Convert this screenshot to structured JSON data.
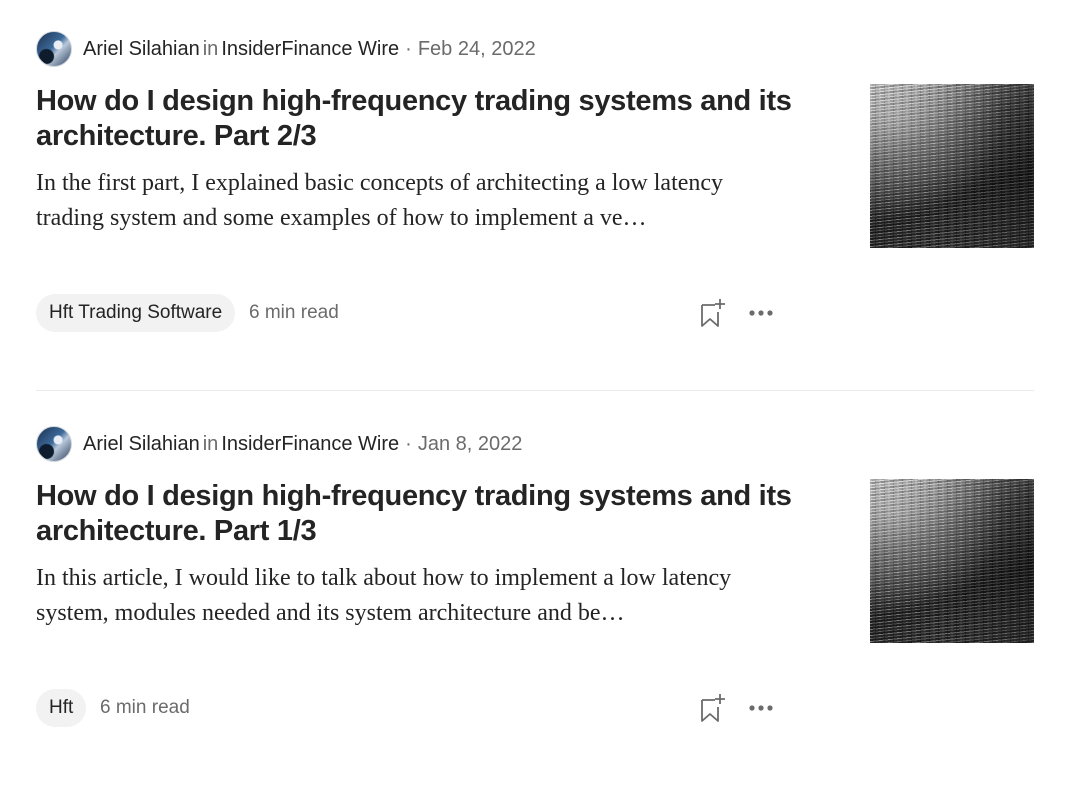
{
  "articles": [
    {
      "author": "Ariel Silahian",
      "in_word": "in",
      "publication": "InsiderFinance Wire",
      "separator": "·",
      "date": "Feb 24, 2022",
      "title": "How do I design high-frequency trading systems and its architecture. Part 2/3",
      "snippet": "In the first part, I explained basic concepts of architecting a low latency trading system and some examples of how to implement a ve…",
      "tag": "Hft Trading Software",
      "read_time": "6 min read"
    },
    {
      "author": "Ariel Silahian",
      "in_word": "in",
      "publication": "InsiderFinance Wire",
      "separator": "·",
      "date": "Jan 8, 2022",
      "title": "How do I design high-frequency trading systems and its architecture. Part 1/3",
      "snippet": "In this article, I would like to talk about how to implement a low latency system, modules needed and its system architecture and be…",
      "tag": "Hft",
      "read_time": "6 min read"
    }
  ],
  "icons": {
    "bookmark": "bookmark-add-icon",
    "more": "more-options-icon"
  }
}
